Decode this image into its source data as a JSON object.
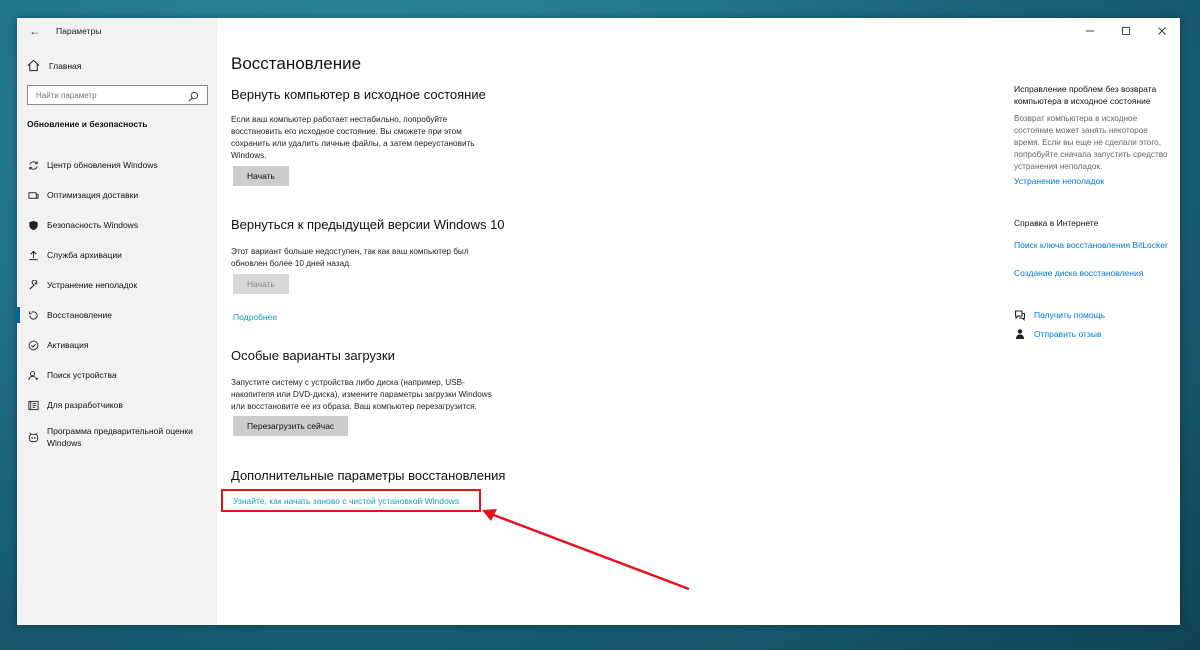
{
  "window": {
    "title": "Параметры"
  },
  "sidebar": {
    "home_label": "Главная",
    "search_placeholder": "Найти параметр",
    "section_title": "Обновление и безопасность",
    "items": [
      {
        "label": "Центр обновления Windows",
        "icon": "sync-icon"
      },
      {
        "label": "Оптимизация доставки",
        "icon": "delivery-icon"
      },
      {
        "label": "Безопасность Windows",
        "icon": "shield-icon"
      },
      {
        "label": "Служба архивации",
        "icon": "upload-icon"
      },
      {
        "label": "Устранение неполадок",
        "icon": "wrench-icon"
      },
      {
        "label": "Восстановление",
        "icon": "restore-icon",
        "selected": true
      },
      {
        "label": "Активация",
        "icon": "check-circle-icon"
      },
      {
        "label": "Поиск устройства",
        "icon": "person-location-icon"
      },
      {
        "label": "Для разработчиков",
        "icon": "developer-icon"
      },
      {
        "label": "Программа предварительной оценки Windows",
        "icon": "insider-icon"
      }
    ]
  },
  "main": {
    "page_title": "Восстановление",
    "reset": {
      "heading": "Вернуть компьютер в исходное состояние",
      "text": "Если ваш компьютер работает нестабильно, попробуйте восстановить его исходное состояние. Вы сможете при этом сохранить или удалить личные файлы, а затем переустановить Windows.",
      "button": "Начать"
    },
    "rollback": {
      "heading": "Вернуться к предыдущей версии Windows 10",
      "text": "Этот вариант больше недоступен, так как ваш компьютер был обновлен более 10 дней назад.",
      "button": "Начать",
      "link": "Подробнее"
    },
    "advanced_startup": {
      "heading": "Особые варианты загрузки",
      "text": "Запустите систему с устройства либо диска (например, USB-накопителя или DVD-диска), измените параметры загрузки Windows или восстановите ее из образа. Ваш компьютер перезагрузится.",
      "button": "Перезагрузить сейчас"
    },
    "more_options": {
      "heading": "Дополнительные параметры восстановления",
      "link": "Узнайте, как начать заново с чистой установкой Windows"
    }
  },
  "right_panel": {
    "fix_title": "Исправление проблем без возврата компьютера в исходное состояние",
    "fix_text": "Возврат компьютера в исходное состояние может занять некоторое время. Если вы еще не сделали этого, попробуйте сначала запустить средство устранения неполадок.",
    "fix_link": "Устранение неполадок",
    "web_help_title": "Справка в Интернете",
    "links": [
      "Поиск ключа восстановления BitLocker",
      "Создание диска восстановления"
    ],
    "get_help": "Получить помощь",
    "feedback": "Отправить отзыв"
  },
  "colors": {
    "accent": "#0078d4",
    "annotation": "#e3121d"
  }
}
